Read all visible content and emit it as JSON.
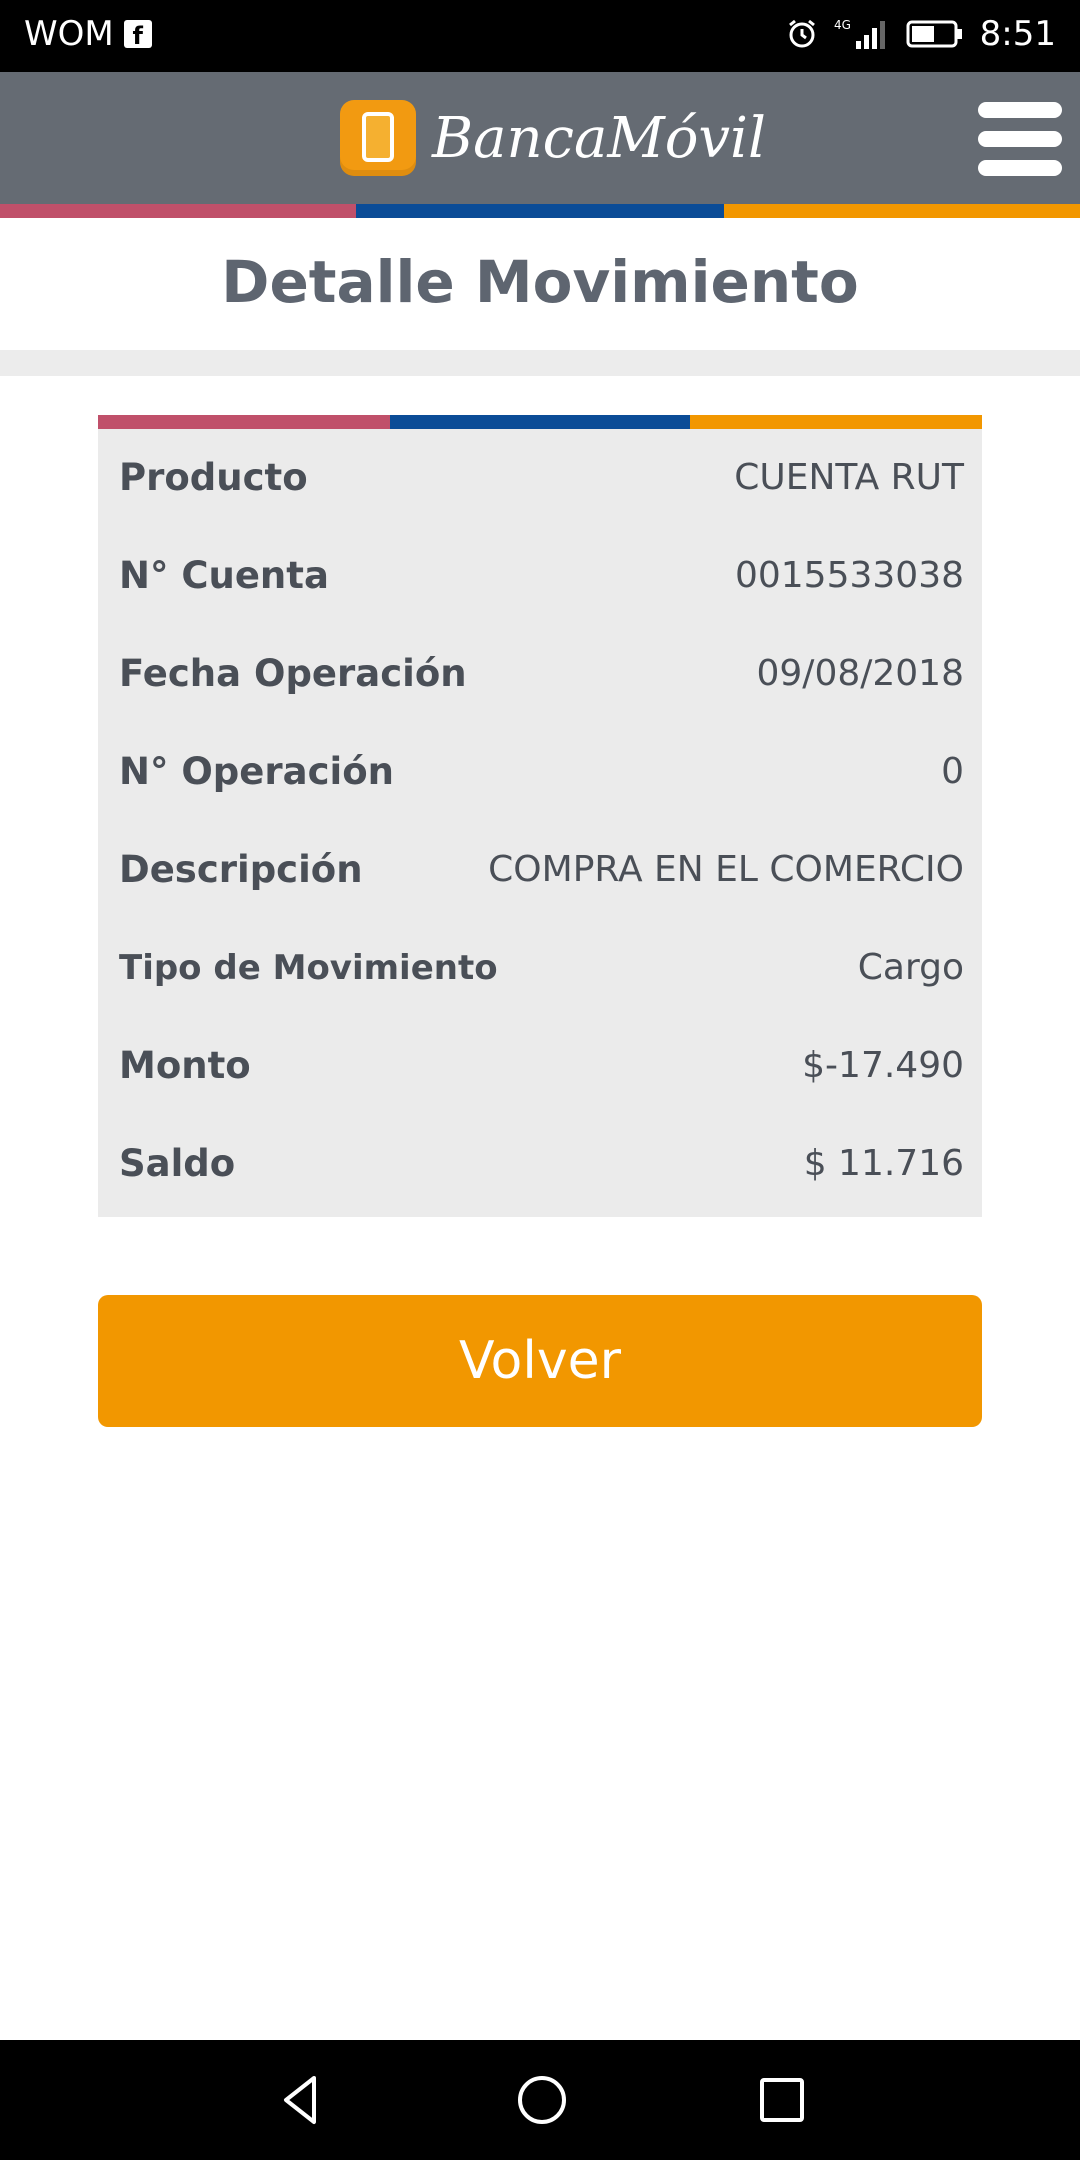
{
  "status_bar": {
    "carrier": "WOM",
    "network": "4G",
    "time": "8:51",
    "icons": [
      "facebook-icon",
      "alarm-icon",
      "signal-icon",
      "battery-icon"
    ]
  },
  "header": {
    "app_name": "BancaMóvil",
    "menu_icon": "hamburger-menu-icon"
  },
  "colors": {
    "stripe_red": "#c0506a",
    "stripe_blue": "#0b4c97",
    "stripe_orange": "#f29700",
    "header_bg": "#656b73",
    "button_bg": "#f29700"
  },
  "page_title": "Detalle Movimiento",
  "details": [
    {
      "label": "Producto",
      "value": "CUENTA RUT"
    },
    {
      "label": "N° Cuenta",
      "value": "0015533038"
    },
    {
      "label": "Fecha Operación",
      "value": "09/08/2018"
    },
    {
      "label": "N° Operación",
      "value": "0"
    },
    {
      "label": "Descripción",
      "value": "COMPRA EN EL COMERCIO"
    },
    {
      "label": "Tipo de Movimiento",
      "value": "Cargo"
    },
    {
      "label": "Monto",
      "value": "$-17.490"
    },
    {
      "label": "Saldo",
      "value": "$ 11.716"
    }
  ],
  "buttons": {
    "back_label": "Volver"
  },
  "nav": {
    "icons": [
      "back-icon",
      "home-icon",
      "recent-apps-icon"
    ]
  }
}
